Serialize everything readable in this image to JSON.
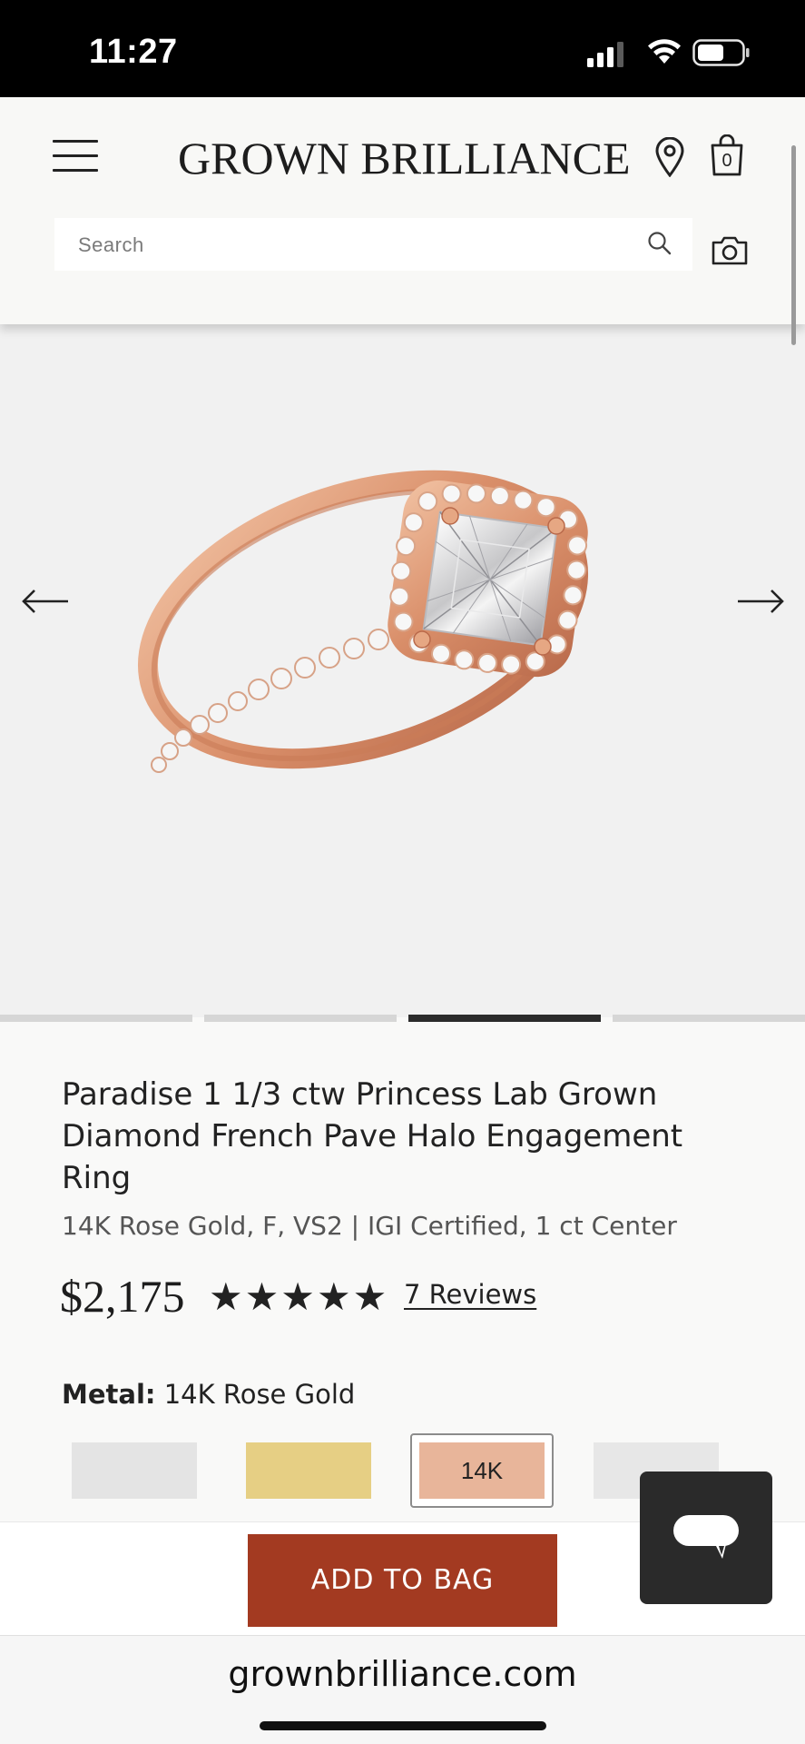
{
  "status_bar": {
    "time": "11:27",
    "battery_icon": "battery-icon",
    "wifi_icon": "wifi-icon",
    "signal_icon": "signal-icon"
  },
  "header": {
    "logo": "GROWN BRILLIANCE",
    "bag_count": "0",
    "search_placeholder": "Search"
  },
  "gallery": {
    "image": "rose gold princess halo engagement ring",
    "slide_count": 4,
    "active_slide": 3
  },
  "product": {
    "title": "Paradise 1 1/3 ctw Princess Lab Grown Diamond French Pave Halo Engagement Ring",
    "subtitle": "14K Rose Gold, F, VS2 | IGI Certified, 1 ct Center",
    "price": "$2,175",
    "rating": 5,
    "stars": "★★★★★",
    "reviews": "7 Reviews"
  },
  "metal": {
    "label_prefix": "Metal:",
    "label_value": "14K Rose Gold",
    "selected_swatch_label": "14K",
    "colors": {
      "white": "#e4e4e4",
      "yellow": "#e6cf84",
      "rose": "#e8b59a",
      "platinum": "#e7e7e7"
    }
  },
  "actions": {
    "add_to_bag": "ADD TO BAG"
  },
  "browser": {
    "url": "grownbrilliance.com"
  },
  "colors": {
    "accent": "#a33a21",
    "chat_bg": "#2a2a2a"
  }
}
